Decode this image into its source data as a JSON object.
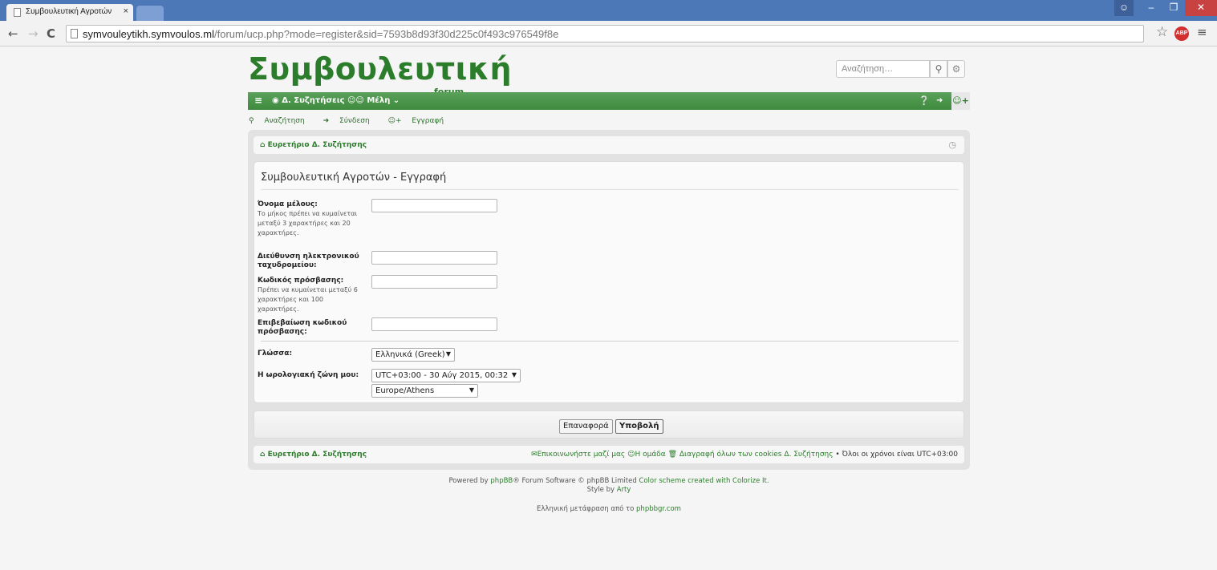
{
  "browser": {
    "tab_title": "Συμβουλευτική Αγροτών",
    "tab_close": "×",
    "url_host": "symvouleytikh.symvoulos.ml",
    "url_path": "/forum/ucp.php?mode=register&sid=7593b8d93f30d225c0f493c976549f8e",
    "abp_label": "ABP",
    "win_min": "–",
    "win_max": "❐",
    "win_close": "✕"
  },
  "header": {
    "logo": "Συμβουλευτική",
    "logo_sub": "forum",
    "search_placeholder": "Αναζήτηση…"
  },
  "navbar": {
    "forums": "Δ. Συζητήσεις",
    "members": "Μέλη"
  },
  "quicklinks": {
    "search": "Αναζήτηση",
    "login": "Σύνδεση",
    "register": "Εγγραφή"
  },
  "breadcrumb": "Ευρετήριο Δ. Συζήτησης",
  "form": {
    "title": "Συμβουλευτική Αγροτών - Εγγραφή",
    "username_label": "Όνομα μέλους:",
    "username_hint": "Το μήκος πρέπει να κυμαίνεται μεταξύ 3 χαρακτήρες και 20 χαρακτήρες.",
    "email_label": "Διεύθυνση ηλεκτρονικού ταχυδρομείου:",
    "password_label": "Κωδικός πρόσβασης:",
    "password_hint": "Πρέπει να κυμαίνεται μεταξύ 6 χαρακτήρες και 100 χαρακτήρες.",
    "confirm_label": "Επιβεβαίωση κωδικού πρόσβασης:",
    "language_label": "Γλώσσα:",
    "language_value": "Ελληνικά (Greek)",
    "timezone_label": "Η ωρολογιακή ζώνη μου:",
    "timezone_value": "UTC+03:00 - 30 Αύγ 2015, 00:32",
    "timezone_city": "Europe/Athens",
    "reset": "Επαναφορά",
    "submit": "Υποβολή"
  },
  "footer": {
    "index": "Ευρετήριο Δ. Συζήτησης",
    "contact": "Επικοινωνήστε μαζί μας",
    "team": "Η ομάδα",
    "delete_cookies": "Διαγραφή όλων των cookies Δ. Συζήτησης",
    "times": "• Όλοι οι χρόνοι είναι UTC+03:00",
    "powered_prefix": "Powered by ",
    "phpbb": "phpBB",
    "powered_suffix": "® Forum Software © phpBB Limited ",
    "color_scheme": "Color scheme created with Colorize It.",
    "style_prefix": "Style by ",
    "style_author": "Arty",
    "translation_prefix": "Ελληνική μετάφραση από το ",
    "translation_site": "phpbbgr.com"
  },
  "colors": {
    "brand_green": "#2b7d2b",
    "navbar_green": "#4a944a",
    "chrome_blue": "#4c78b8"
  }
}
